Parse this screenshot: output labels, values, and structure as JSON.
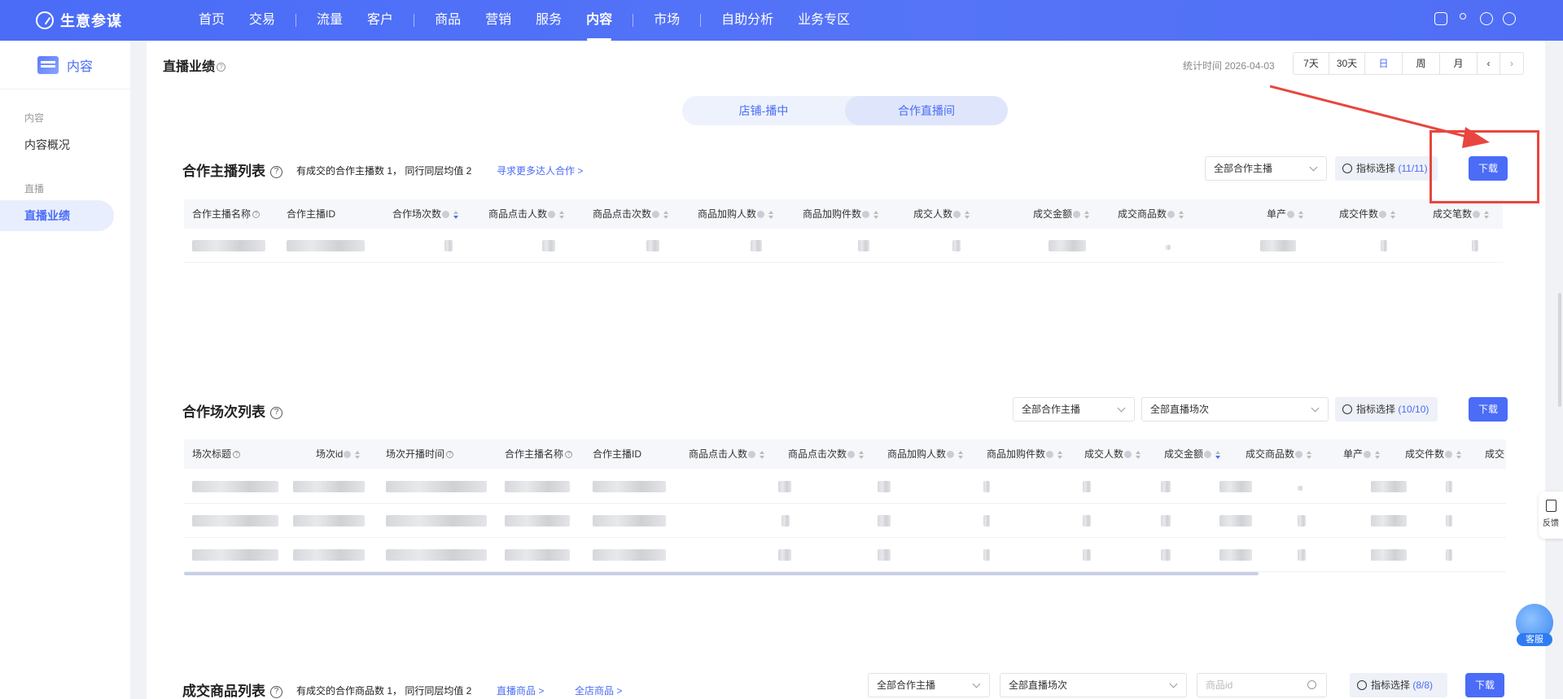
{
  "brand": {
    "name": "生意参谋"
  },
  "nav": {
    "items": [
      "首页",
      "交易",
      "流量",
      "客户",
      "商品",
      "营销",
      "服务",
      "内容",
      "市场",
      "自助分析",
      "业务专区"
    ],
    "active": "内容"
  },
  "sidebar": {
    "title": "内容",
    "groups": [
      {
        "label": "内容",
        "items": [
          "内容概况"
        ]
      },
      {
        "label": "直播",
        "items": [
          "直播业绩"
        ]
      }
    ],
    "active_item": "直播业绩"
  },
  "page": {
    "title": "直播业绩",
    "stat_time": "统计时间 2026-04-03",
    "periods": [
      "7天",
      "30天",
      "日",
      "周",
      "月"
    ],
    "active_period": "日",
    "tabs": [
      "店铺-播中",
      "合作直播间"
    ],
    "active_tab": "合作直播间"
  },
  "section1": {
    "title": "合作主播列表",
    "note": "有成交的合作主播数 1， 同行同层均值 2",
    "link": "寻求更多达人合作 >",
    "select": "全部合作主播",
    "metric_label": "指标选择",
    "metric_count": "(11/11)",
    "download": "下载",
    "columns": [
      "合作主播名称",
      "合作主播ID",
      "合作场次数",
      "商品点击人数",
      "商品点击次数",
      "商品加购人数",
      "商品加购件数",
      "成交人数",
      "成交金额",
      "成交商品数",
      "单产",
      "成交件数",
      "成交笔数"
    ]
  },
  "section2": {
    "title": "合作场次列表",
    "select1": "全部合作主播",
    "select2": "全部直播场次",
    "metric_label": "指标选择",
    "metric_count": "(10/10)",
    "download": "下载",
    "columns": [
      "场次标题",
      "场次id",
      "场次开播时间",
      "合作主播名称",
      "合作主播ID",
      "商品点击人数",
      "商品点击次数",
      "商品加购人数",
      "商品加购件数",
      "成交人数",
      "成交金额",
      "成交商品数",
      "单产",
      "成交件数",
      "成交"
    ]
  },
  "section3": {
    "title": "成交商品列表",
    "note": "有成交的合作商品数 1， 同行同层均值 2",
    "link1": "直播商品 >",
    "link2": "全店商品 >",
    "select1": "全部合作主播",
    "select2": "全部直播场次",
    "search_placeholder": "商品id",
    "metric_label": "指标选择",
    "metric_count": "(8/8)",
    "download": "下载"
  },
  "float": {
    "feedback": "反馈",
    "service": "客服"
  },
  "colors": {
    "primary": "#4a6cf7",
    "annotation": "#e8463f"
  }
}
